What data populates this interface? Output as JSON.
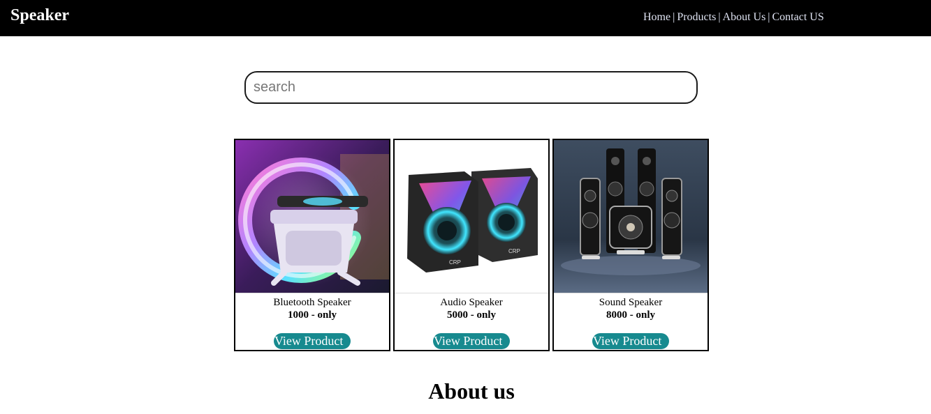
{
  "header": {
    "brand": "Speaker",
    "nav": [
      {
        "label": "Home"
      },
      {
        "label": "Products"
      },
      {
        "label": "About Us"
      },
      {
        "label": "Contact US"
      }
    ],
    "separator": "|"
  },
  "search": {
    "placeholder": "search",
    "value": ""
  },
  "products": [
    {
      "name": "Bluetooth Speaker",
      "price": "1000 - only",
      "button": "View Product",
      "image": "rgb-lamp-speaker-image"
    },
    {
      "name": "Audio Speaker",
      "price": "5000 - only",
      "button": "View Product",
      "image": "desktop-speakers-image"
    },
    {
      "name": "Sound Speaker",
      "price": "8000 - only",
      "button": "View Product",
      "image": "home-theater-speakers-image"
    }
  ],
  "about": {
    "heading": "About us"
  },
  "colors": {
    "header_bg": "#000000",
    "nav_link": "#dfe3f2",
    "button_bg": "#178a8f"
  }
}
